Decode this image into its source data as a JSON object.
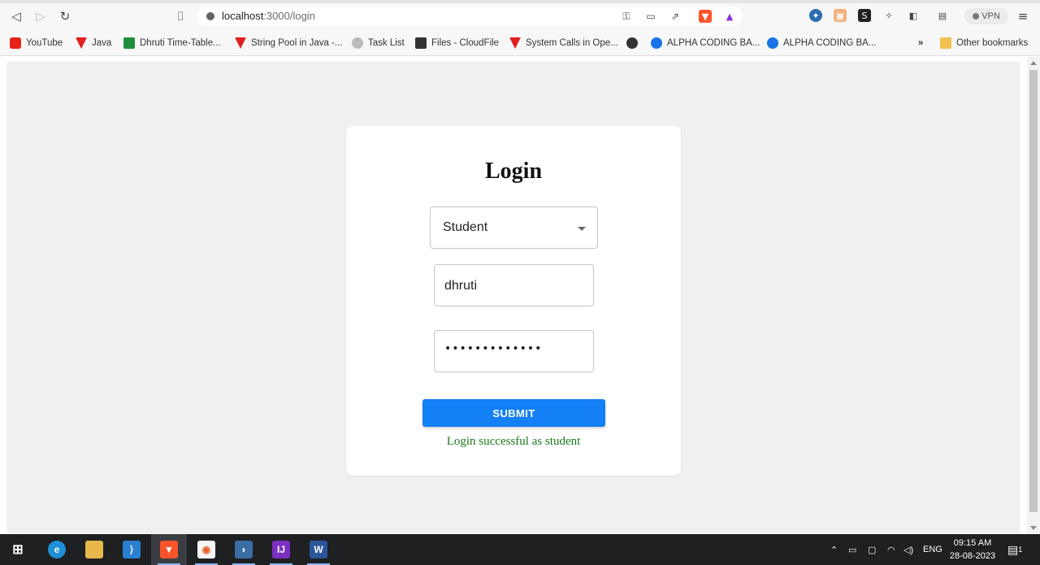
{
  "browser": {
    "url_host": "localhost",
    "url_path": ":3000/login",
    "vpn_label": "VPN"
  },
  "bookmarks": [
    {
      "label": "YouTube",
      "color": "#e62117"
    },
    {
      "label": "Java",
      "color": "#e02020"
    },
    {
      "label": "Dhruti Time-Table...",
      "color": "#1e8e3e"
    },
    {
      "label": "String Pool in Java -...",
      "color": "#e02020"
    },
    {
      "label": "Task List",
      "color": "#888888"
    },
    {
      "label": "Files - CloudFile",
      "color": "#333333"
    },
    {
      "label": "System Calls in Ope...",
      "color": "#e02020"
    },
    {
      "label": "",
      "color": "#333333"
    },
    {
      "label": "ALPHA CODING BA...",
      "color": "#1a73e8"
    },
    {
      "label": "ALPHA CODING BA...",
      "color": "#1a73e8"
    }
  ],
  "bookmarks_more": "»",
  "other_bookmarks": "Other bookmarks",
  "login": {
    "title": "Login",
    "role_selected": "Student",
    "username": "dhruti",
    "password_mask": "•••••••••••••",
    "submit_label": "SUBMIT",
    "message": "Login successful as student",
    "message_color": "#1a7a1a",
    "accent": "#1380f5"
  },
  "taskbar": {
    "time": "09:15 AM",
    "date": "28-08-2023",
    "lang": "ENG",
    "notification_count": "1"
  }
}
